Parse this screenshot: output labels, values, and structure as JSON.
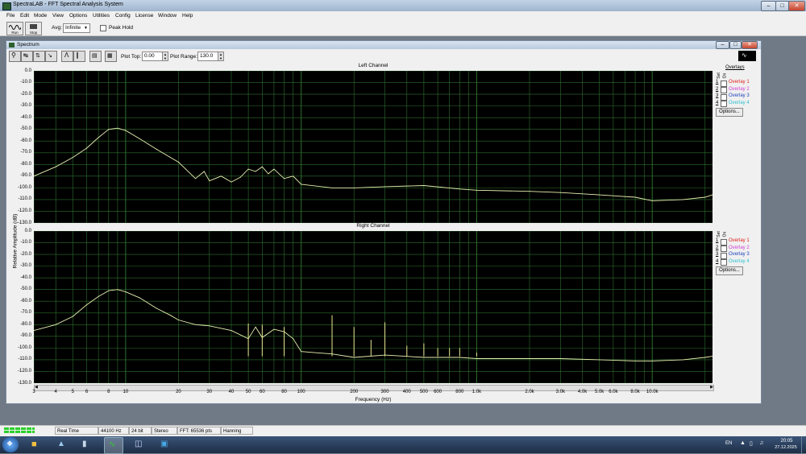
{
  "window": {
    "title": "SpectraLAB - FFT Spectral Analysis System"
  },
  "menu": [
    "File",
    "Edit",
    "Mode",
    "View",
    "Options",
    "Utilities",
    "Config",
    "License",
    "Window",
    "Help"
  ],
  "toolbar": {
    "run_label": "Run",
    "stop_label": "Stop",
    "avg_label": "Avg:",
    "avg_value": "Infinite",
    "peak_hold_label": "Peak Hold"
  },
  "spectrum": {
    "title": "Spectrum",
    "plot_top_label": "Plot Top:",
    "plot_top_value": "0.00",
    "plot_range_label": "Plot Range:",
    "plot_range_value": "130.0",
    "left_title": "Left Channel",
    "right_title": "Right Channel",
    "y_axis_label": "Relative Amplitude (dB)",
    "x_axis_label": "Frequency (Hz)",
    "overlays_label": "Overlays",
    "set_label": "Set",
    "on_label": "On",
    "options_label": "Options...",
    "overlays": [
      {
        "num": "1",
        "name": "Overlay 1",
        "color": "#e02020"
      },
      {
        "num": "2",
        "name": "Overlay 2",
        "color": "#d040d0"
      },
      {
        "num": "3",
        "name": "Overlay 3",
        "color": "#2040c0"
      },
      {
        "num": "4",
        "name": "Overlay 4",
        "color": "#30c0d0"
      }
    ]
  },
  "status": [
    "Real Time",
    "44100 Hz",
    "24 bit",
    "Stereo",
    "FFT: 65536 pts",
    "Hanning"
  ],
  "taskbar": {
    "lang": "EN",
    "time": "20:05",
    "date": "27.12.2025"
  },
  "chart_data": [
    {
      "type": "line",
      "title": "Left Channel",
      "xlabel": "Frequency (Hz)",
      "ylabel": "Relative Amplitude (dB)",
      "x_scale": "log",
      "xlim": [
        3,
        22050
      ],
      "ylim": [
        -130,
        0
      ],
      "yticks": [
        "0.0",
        "-10.0",
        "-20.0",
        "-30.0",
        "-40.0",
        "-50.0",
        "-60.0",
        "-70.0",
        "-80.0",
        "-90.0",
        "-100.0",
        "-110.0",
        "-120.0",
        "-130.0"
      ],
      "grid": true,
      "line_color": "#e8f0b0",
      "x": [
        3,
        4,
        5,
        6,
        7,
        8,
        9,
        10,
        12,
        15,
        18,
        20,
        22,
        25,
        28,
        30,
        35,
        40,
        45,
        50,
        55,
        60,
        65,
        70,
        80,
        90,
        100,
        150,
        200,
        300,
        500,
        800,
        1000,
        2000,
        3000,
        5000,
        8000,
        10000,
        15000,
        20000,
        22000
      ],
      "y": [
        -90,
        -82,
        -74,
        -66,
        -57,
        -50,
        -49,
        -51,
        -58,
        -67,
        -74,
        -78,
        -84,
        -92,
        -86,
        -94,
        -90,
        -95,
        -91,
        -84,
        -86,
        -82,
        -88,
        -84,
        -92,
        -90,
        -97,
        -100,
        -100,
        -99,
        -98,
        -101,
        -102,
        -103,
        -104,
        -106,
        -108,
        -111,
        -110,
        -108,
        -106
      ]
    },
    {
      "type": "line",
      "title": "Right Channel",
      "xlabel": "Frequency (Hz)",
      "ylabel": "Relative Amplitude (dB)",
      "x_scale": "log",
      "xlim": [
        3,
        22050
      ],
      "ylim": [
        -130,
        0
      ],
      "yticks": [
        "0.0",
        "-10.0",
        "-20.0",
        "-30.0",
        "-40.0",
        "-50.0",
        "-60.0",
        "-70.0",
        "-80.0",
        "-90.0",
        "-100.0",
        "-110.0",
        "-120.0",
        "-130.0"
      ],
      "xticks": [
        "3",
        "4",
        "5",
        "6",
        "8",
        "10",
        "20",
        "30",
        "40",
        "50",
        "60",
        "80",
        "100",
        "200",
        "300",
        "400",
        "500",
        "600",
        "800",
        "1.0k",
        "2.0k",
        "3.0k",
        "4.0k",
        "5.0k",
        "6.0k",
        "8.0k",
        "10.0k"
      ],
      "grid": true,
      "line_color": "#e8f0b0",
      "x": [
        3,
        4,
        5,
        6,
        7,
        8,
        9,
        10,
        12,
        15,
        18,
        20,
        25,
        30,
        40,
        50,
        55,
        60,
        70,
        80,
        90,
        100,
        150,
        200,
        300,
        500,
        800,
        1000,
        2000,
        3000,
        5000,
        8000,
        10000,
        15000,
        20000,
        22000
      ],
      "y": [
        -85,
        -80,
        -73,
        -63,
        -56,
        -51,
        -50,
        -52,
        -57,
        -66,
        -72,
        -76,
        -80,
        -81,
        -85,
        -92,
        -82,
        -91,
        -84,
        -86,
        -92,
        -103,
        -105,
        -108,
        -106,
        -108,
        -108,
        -109,
        -109,
        -109,
        -110,
        -111,
        -111,
        -110,
        -108,
        -107
      ],
      "spikes_x": [
        50,
        60,
        80,
        150,
        200,
        250,
        300,
        400,
        500,
        600,
        700,
        800,
        1000
      ],
      "spikes_y": [
        -79,
        -80,
        -82,
        -72,
        -82,
        -93,
        -78,
        -98,
        -96,
        -100,
        -100,
        -100,
        -104
      ]
    }
  ]
}
